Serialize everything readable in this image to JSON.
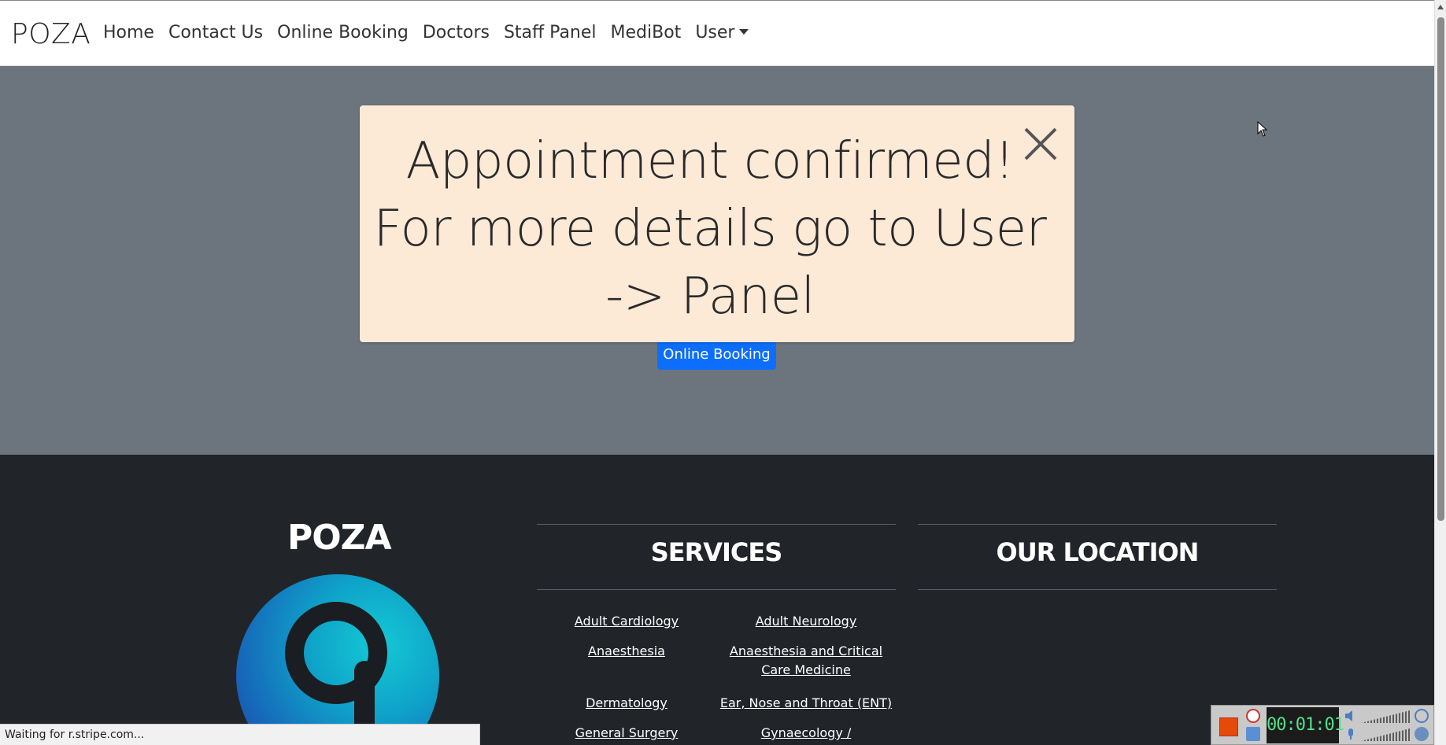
{
  "navbar": {
    "brand": "POZA",
    "links": [
      "Home",
      "Contact Us",
      "Online Booking",
      "Doctors",
      "Staff Panel",
      "MediBot",
      "User"
    ]
  },
  "modal": {
    "message": "Appointment confirmed! For more details go to User -> Panel",
    "close_icon": "close-icon"
  },
  "hero": {
    "booking_button": "Online Booking",
    "bg_color": "#6c757d",
    "button_color": "#0d6efd"
  },
  "footer": {
    "brand": "POZA",
    "services_title": "SERVICES",
    "location_title": "OUR LOCATION",
    "services": [
      "Adult Cardiology",
      "Adult Neurology",
      "Anaesthesia",
      "Anaesthesia and Critical Care Medicine",
      "Dermatology",
      "Ear, Nose and Throat (ENT)",
      "General Surgery",
      "Gynaecology /"
    ],
    "bg_color": "#212529"
  },
  "statusbar": {
    "text": "Waiting for r.stripe.com..."
  },
  "recorder": {
    "timer": "00:01:01"
  }
}
